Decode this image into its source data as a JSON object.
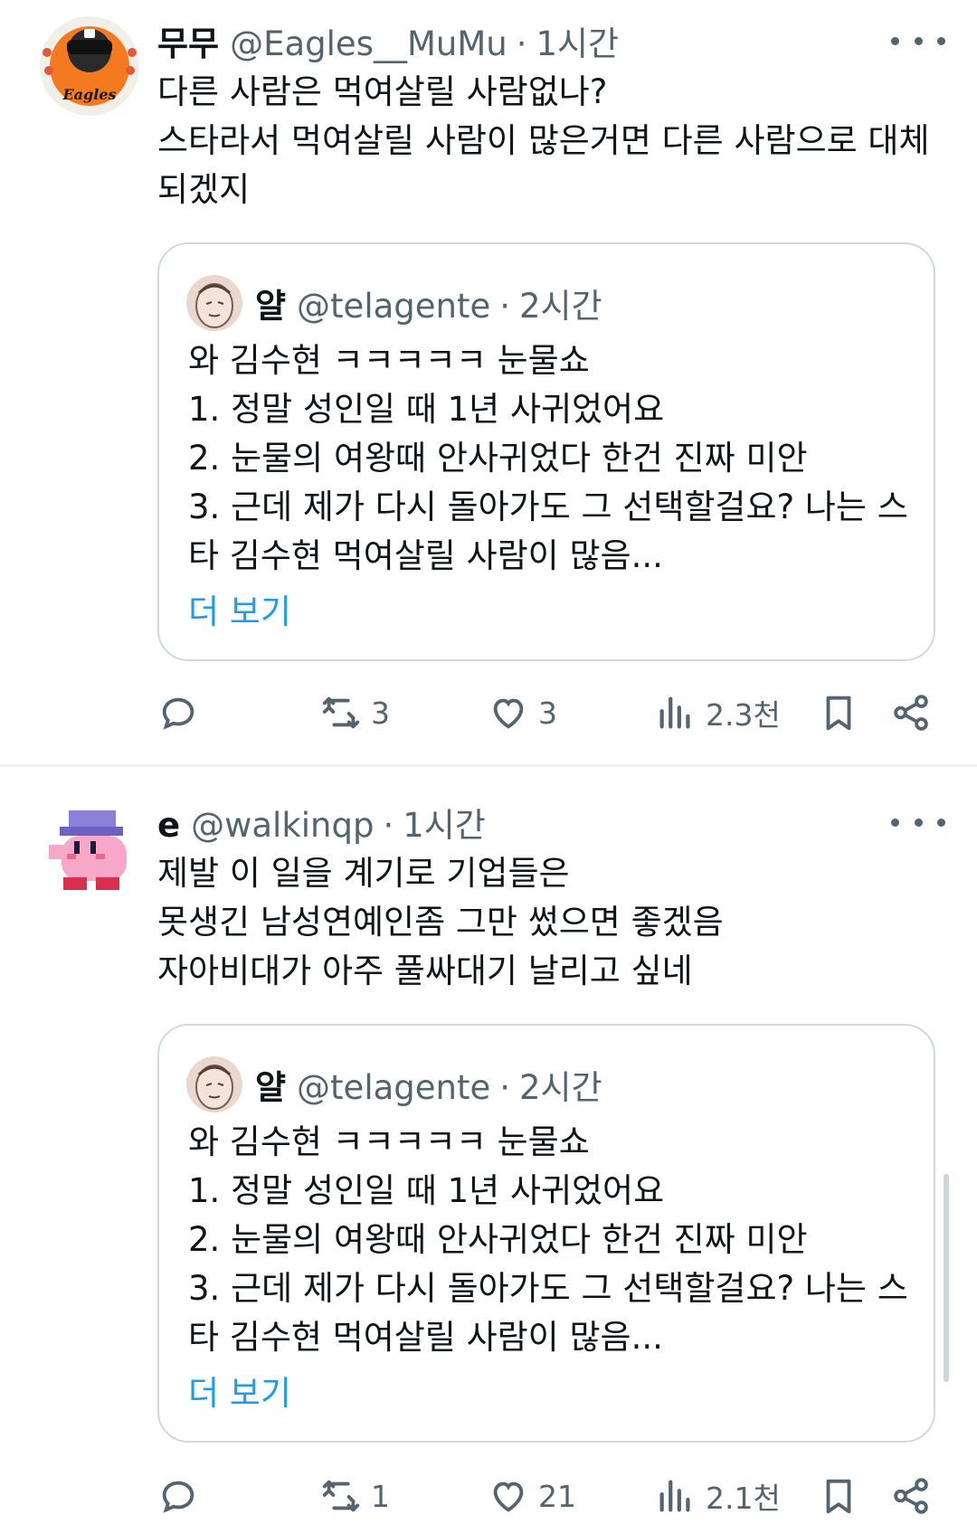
{
  "tweets": [
    {
      "name": "무무",
      "handle": "@Eagles__MuMu",
      "separator": "·",
      "time": "1시간",
      "avatar_text": "Eagles",
      "text_lines": [
        "다른 사람은 먹여살릴 사람없나?",
        "스타라서 먹여살릴 사람이 많은거면 다른 사람으로 대체",
        "되겠지"
      ],
      "quote": {
        "name": "얄",
        "handle": "@telagente",
        "separator": "·",
        "time": "2시간",
        "text_lines": [
          "와 김수현 ㅋㅋㅋㅋㅋ 눈물쇼",
          "1. 정말 성인일 때 1년 사귀었어요",
          "2. 눈물의 여왕때 안사귀었다 한건 진짜 미안",
          "3. 근데 제가 다시 돌아가도 그 선택할걸요? 나는 스",
          "타 김수현 먹여살릴 사람이 많음..."
        ],
        "more_label": "더 보기"
      },
      "actions": {
        "retweets": "3",
        "likes": "3",
        "views": "2.3천"
      }
    },
    {
      "name": "e",
      "handle": "@walkinqp",
      "separator": "·",
      "time": "1시간",
      "text_lines": [
        "제발 이 일을 계기로 기업들은",
        "못생긴 남성연예인좀 그만 썼으면 좋겠음",
        "자아비대가 아주 풀싸대기 날리고 싶네"
      ],
      "quote": {
        "name": "얄",
        "handle": "@telagente",
        "separator": "·",
        "time": "2시간",
        "text_lines": [
          "와 김수현 ㅋㅋㅋㅋㅋ 눈물쇼",
          "1. 정말 성인일 때 1년 사귀었어요",
          "2. 눈물의 여왕때 안사귀었다 한건 진짜 미안",
          "3. 근데 제가 다시 돌아가도 그 선택할걸요? 나는 스",
          "타 김수현 먹여살릴 사람이 많음..."
        ],
        "more_label": "더 보기"
      },
      "actions": {
        "retweets": "1",
        "likes": "21",
        "views": "2.1천"
      }
    }
  ],
  "colors": {
    "text": "#0f1419",
    "secondary": "#536471",
    "link": "#1d9bf0",
    "border": "#cfd9de"
  },
  "icons": [
    "reply-icon",
    "retweet-icon",
    "like-icon",
    "views-icon",
    "bookmark-icon",
    "share-icon",
    "more-icon"
  ]
}
